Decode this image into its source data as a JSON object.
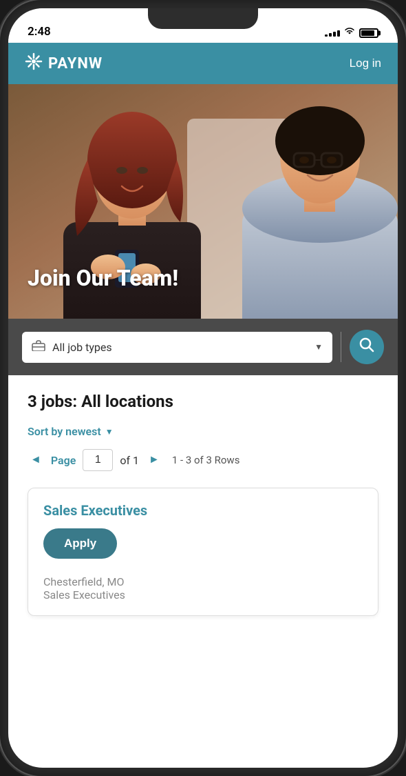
{
  "statusBar": {
    "time": "2:48",
    "signalBars": [
      3,
      5,
      7,
      9,
      11
    ],
    "batteryPercent": 85
  },
  "header": {
    "logoText": "PAYNW",
    "loginLabel": "Log in"
  },
  "hero": {
    "headline": "Join Our Team!"
  },
  "searchBar": {
    "jobTypeLabel": "All job types",
    "jobTypePlaceholder": "All job types",
    "searchAriaLabel": "Search jobs"
  },
  "jobsSection": {
    "title": "3 jobs: All locations",
    "sortLabel": "Sort by newest",
    "pagination": {
      "pageLabel": "Page",
      "currentPage": "1",
      "ofLabel": "of 1",
      "rowsInfo": "1 - 3 of 3 Rows"
    },
    "jobCard": {
      "title": "Sales Executives",
      "applyLabel": "Apply",
      "location": "Chesterfield, MO",
      "subtitle": "Sales Executives"
    }
  }
}
